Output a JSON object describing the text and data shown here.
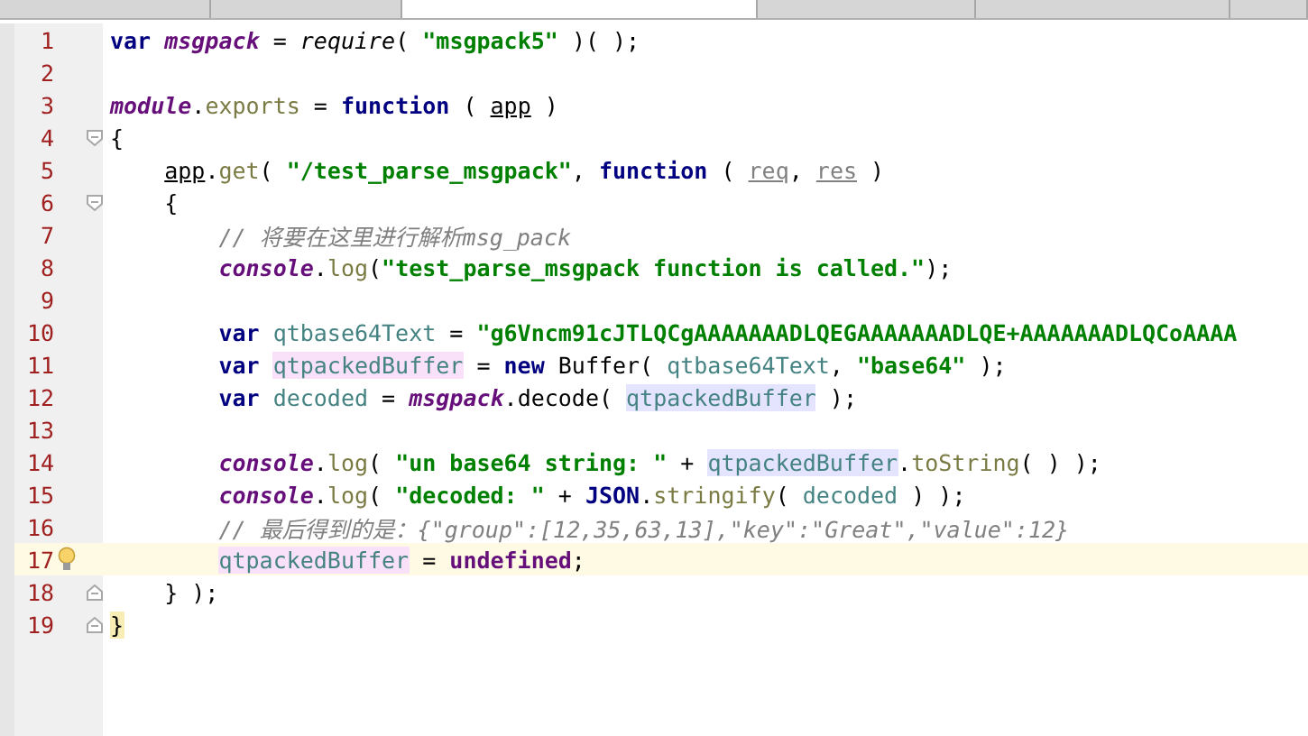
{
  "tabs": [
    {
      "selected": false
    },
    {
      "selected": false
    },
    {
      "selected": true
    },
    {
      "selected": false
    },
    {
      "selected": false
    },
    {
      "selected": false
    }
  ],
  "lines": [
    {
      "number": "1",
      "current": false,
      "bulb": false,
      "tokens": [
        {
          "t": "var ",
          "kind": "kw"
        },
        {
          "t": "msgpack",
          "kind": "global"
        },
        {
          "t": " = ",
          "kind": "plain"
        },
        {
          "t": "require",
          "kind": "call"
        },
        {
          "t": "( ",
          "kind": "plain"
        },
        {
          "t": "\"msgpack5\"",
          "kind": "str"
        },
        {
          "t": " )( );",
          "kind": "plain"
        }
      ]
    },
    {
      "number": "2",
      "current": false,
      "bulb": false
    },
    {
      "number": "3",
      "current": false,
      "bulb": false,
      "tokens": [
        {
          "t": "module",
          "kind": "global"
        },
        {
          "t": ".",
          "kind": "plain"
        },
        {
          "t": "exports",
          "kind": "member"
        },
        {
          "t": " = ",
          "kind": "plain"
        },
        {
          "t": "function",
          "kind": "kw"
        },
        {
          "t": " ( ",
          "kind": "plain"
        },
        {
          "t": "app",
          "kind": "param"
        },
        {
          "t": " )",
          "kind": "plain"
        }
      ]
    },
    {
      "number": "4",
      "current": false,
      "bulb": false,
      "fold_start": true,
      "tokens": [
        {
          "t": "{",
          "kind": "plain"
        }
      ]
    },
    {
      "number": "5",
      "current": false,
      "bulb": false,
      "tokens": [
        {
          "t": "    app",
          "kind": "param"
        },
        {
          "t": ".",
          "kind": "plain"
        },
        {
          "t": "get",
          "kind": "member"
        },
        {
          "t": "( ",
          "kind": "plain"
        },
        {
          "t": "\"/test_parse_msgpack\"",
          "kind": "str"
        },
        {
          "t": ", ",
          "kind": "plain"
        },
        {
          "t": "function",
          "kind": "kw"
        },
        {
          "t": " ( ",
          "kind": "plain"
        },
        {
          "t": "req",
          "kind": "unused"
        },
        {
          "t": ", ",
          "kind": "plain"
        },
        {
          "t": "res",
          "kind": "unused"
        },
        {
          "t": " )",
          "kind": "plain"
        }
      ]
    },
    {
      "number": "6",
      "current": false,
      "bulb": false,
      "fold_start": true,
      "tokens": [
        {
          "t": "    {",
          "kind": "plain"
        }
      ]
    },
    {
      "number": "7",
      "current": false,
      "bulb": false,
      "tokens": [
        {
          "t": "        // 将要在这里进行解析msg_pack",
          "kind": "comment"
        }
      ]
    },
    {
      "number": "8",
      "current": false,
      "bulb": false,
      "tokens": [
        {
          "t": "        console",
          "kind": "global"
        },
        {
          "t": ".",
          "kind": "plain"
        },
        {
          "t": "log",
          "kind": "member"
        },
        {
          "t": "(",
          "kind": "plain"
        },
        {
          "t": "\"test_parse_msgpack function is called.\"",
          "kind": "str"
        },
        {
          "t": ");",
          "kind": "plain"
        }
      ]
    },
    {
      "number": "9",
      "current": false,
      "bulb": false
    },
    {
      "number": "10",
      "current": false,
      "bulb": false,
      "tokens": [
        {
          "t": "        var ",
          "kind": "kw"
        },
        {
          "t": "qtbase64Text",
          "kind": "local"
        },
        {
          "t": " = ",
          "kind": "plain"
        },
        {
          "t": "\"g6Vncm91cJTLQCgAAAAAAADLQEGAAAAAAADLQE+AAAAAAADLQCoAAAA",
          "kind": "str"
        }
      ]
    },
    {
      "number": "11",
      "current": false,
      "bulb": false,
      "tokens": [
        {
          "t": "        var ",
          "kind": "kw"
        },
        {
          "t": "qtpackedBuffer",
          "kind": "write"
        },
        {
          "t": " = ",
          "kind": "plain"
        },
        {
          "t": "new",
          "kind": "kw"
        },
        {
          "t": " Buffer( ",
          "kind": "plain"
        },
        {
          "t": "qtbase64Text",
          "kind": "local"
        },
        {
          "t": ", ",
          "kind": "plain"
        },
        {
          "t": "\"base64\"",
          "kind": "str"
        },
        {
          "t": " );",
          "kind": "plain"
        }
      ]
    },
    {
      "number": "12",
      "current": false,
      "bulb": false,
      "tokens": [
        {
          "t": "        var ",
          "kind": "kw"
        },
        {
          "t": "decoded",
          "kind": "local"
        },
        {
          "t": " = ",
          "kind": "plain"
        },
        {
          "t": "msgpack",
          "kind": "global"
        },
        {
          "t": ".decode( ",
          "kind": "plain"
        },
        {
          "t": "qtpackedBuffer",
          "kind": "read"
        },
        {
          "t": " );",
          "kind": "plain"
        }
      ]
    },
    {
      "number": "13",
      "current": false,
      "bulb": false
    },
    {
      "number": "14",
      "current": false,
      "bulb": false,
      "tokens": [
        {
          "t": "        console",
          "kind": "global"
        },
        {
          "t": ".",
          "kind": "plain"
        },
        {
          "t": "log",
          "kind": "member"
        },
        {
          "t": "( ",
          "kind": "plain"
        },
        {
          "t": "\"un base64 string: \"",
          "kind": "str"
        },
        {
          "t": " + ",
          "kind": "plain"
        },
        {
          "t": "qtpackedBuffer",
          "kind": "read"
        },
        {
          "t": ".",
          "kind": "plain"
        },
        {
          "t": "toString",
          "kind": "member"
        },
        {
          "t": "( ) );",
          "kind": "plain"
        }
      ]
    },
    {
      "number": "15",
      "current": false,
      "bulb": false,
      "tokens": [
        {
          "t": "        console",
          "kind": "global"
        },
        {
          "t": ".",
          "kind": "plain"
        },
        {
          "t": "log",
          "kind": "member"
        },
        {
          "t": "( ",
          "kind": "plain"
        },
        {
          "t": "\"decoded: \"",
          "kind": "str"
        },
        {
          "t": " + ",
          "kind": "plain"
        },
        {
          "t": "JSON",
          "kind": "kw"
        },
        {
          "t": ".",
          "kind": "plain"
        },
        {
          "t": "stringify",
          "kind": "member"
        },
        {
          "t": "( ",
          "kind": "plain"
        },
        {
          "t": "decoded",
          "kind": "local"
        },
        {
          "t": " ) );",
          "kind": "plain"
        }
      ]
    },
    {
      "number": "16",
      "current": false,
      "bulb": false,
      "tokens": [
        {
          "t": "        // 最后得到的是：{\"group\":[12,35,63,13],\"key\":\"Great\",\"value\":12}",
          "kind": "comment"
        }
      ]
    },
    {
      "number": "17",
      "current": true,
      "bulb": true,
      "tokens": [
        {
          "t": "        qtpackedBuffer",
          "kind": "write"
        },
        {
          "t": " = ",
          "kind": "plain"
        },
        {
          "t": "undefined",
          "kind": "const"
        },
        {
          "t": ";",
          "kind": "plain"
        }
      ]
    },
    {
      "number": "18",
      "current": false,
      "bulb": false,
      "fold_end": true,
      "tokens": [
        {
          "t": "    } );",
          "kind": "plain"
        }
      ]
    },
    {
      "number": "19",
      "current": false,
      "bulb": false,
      "fold_end": true,
      "tokens": [
        {
          "t": "}",
          "kind": "match"
        }
      ]
    }
  ]
}
